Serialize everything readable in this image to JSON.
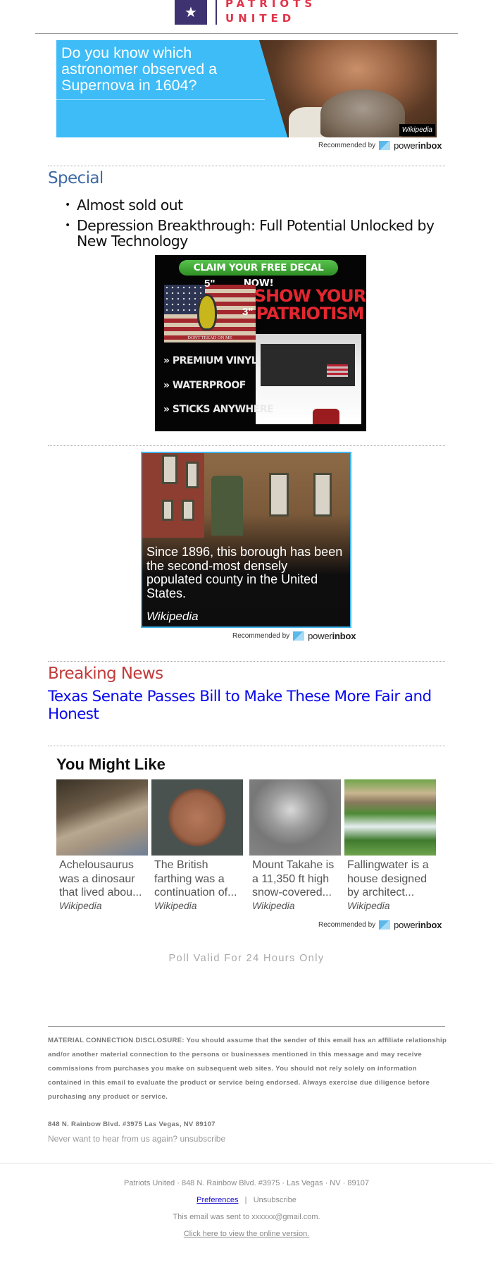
{
  "header": {
    "logo_line1": "PATRIOTS",
    "logo_line2": "UNITED",
    "logo_icon": "star-icon",
    "brand_color": "#e2344a",
    "logo_box_color": "#3e3370"
  },
  "promo_banner": {
    "question": "Do you know which astronomer observed a Supernova in 1604?",
    "source": "Wikipedia",
    "accent_color": "#3dbcf7"
  },
  "recommended": {
    "label": "Recommended by",
    "brand_plain": "power",
    "brand_bold": "inbox",
    "icon": "powerinbox-envelope-icon"
  },
  "special": {
    "title": "Special",
    "title_color": "#3e6aa6",
    "items": [
      {
        "label": "Almost sold out"
      },
      {
        "label": "Depression Breakthrough: Full Potential Unlocked by New Technology"
      }
    ]
  },
  "decal_ad": {
    "cta": "CLAIM YOUR FREE DECAL NOW!",
    "size_width": "5\"",
    "size_height": "3\"",
    "flag_text": "DONT TREAD ON ME",
    "headline_line1": "SHOW YOUR",
    "headline_line2": "PATRIOTISM",
    "features": [
      "PREMIUM VINYL",
      "WATERPROOF",
      "STICKS ANYWHERE"
    ],
    "feature_bullet": "»"
  },
  "wiki_card": {
    "caption": "Since 1896, this borough has been the second-most densely populated county in the United States.",
    "source": "Wikipedia"
  },
  "breaking": {
    "title": "Breaking News",
    "title_color": "#c23a3a",
    "headline": "Texas Senate Passes Bill to Make These More Fair and Honest"
  },
  "you_might_like": {
    "title": "You Might Like",
    "tiles": [
      {
        "text": "Achelousaurus was a dinosaur that lived abou...",
        "source": "Wikipedia"
      },
      {
        "text": "The British farthing was a continuation of...",
        "source": "Wikipedia"
      },
      {
        "text": "Mount Takahe is a 11,350 ft high snow-covered...",
        "source": "Wikipedia"
      },
      {
        "text": "Fallingwater is a house designed by architect...",
        "source": "Wikipedia"
      }
    ]
  },
  "poll_note": "Poll Valid For 24 Hours Only",
  "disclosure": {
    "text": "MATERIAL CONNECTION DISCLOSURE: You should assume that the sender of this email has an affiliate relationship and/or another material connection to the persons or businesses mentioned in this message and may receive commissions from purchases you make on subsequent web sites. You should not rely solely on information contained in this email to evaluate the product or service being endorsed. Always exercise due diligence before purchasing any product or service.",
    "address": "848 N. Rainbow Blvd. #3975 Las Vegas, NV 89107",
    "never_text": "Never want to hear from us again?",
    "unsubscribe_link": "unsubscribe"
  },
  "footer": {
    "address_line": "Patriots United · 848 N. Rainbow Blvd. #3975 · Las Vegas · NV · 89107",
    "preferences": "Preferences",
    "separator": "|",
    "unsubscribe": "Unsubscribe",
    "sent_to": "This email was sent to xxxxxx@gmail.com.",
    "online_version": "Click here to view the online version."
  }
}
